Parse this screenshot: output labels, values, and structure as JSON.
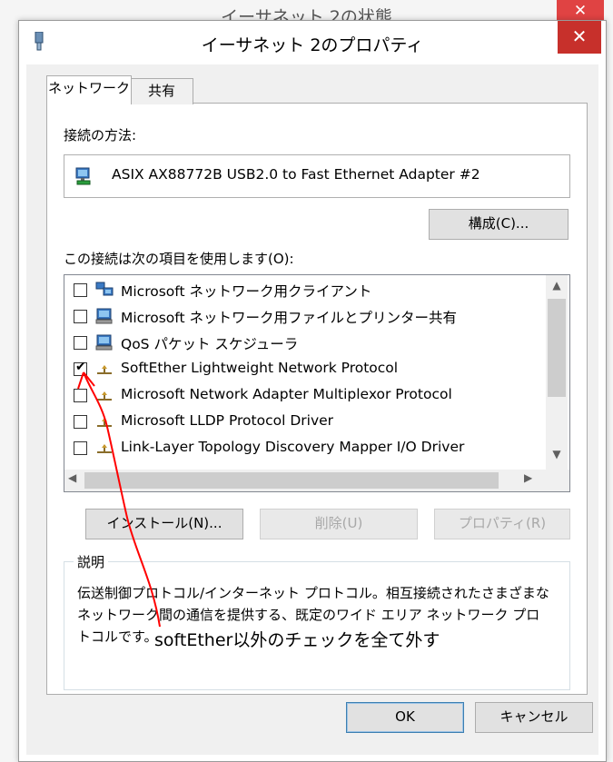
{
  "background_window": {
    "title": "イーサネット 2の状態",
    "close_glyph": "✕"
  },
  "dialog": {
    "title": "イーサネット 2のプロパティ",
    "close_glyph": "✕"
  },
  "tabs": [
    {
      "label": "ネットワーク",
      "selected": true
    },
    {
      "label": "共有",
      "selected": false
    }
  ],
  "connection": {
    "label": "接続の方法:",
    "adapter_name": "ASIX AX88772B USB2.0 to Fast Ethernet Adapter #2",
    "configure_button": "構成(C)..."
  },
  "items": {
    "label": "この接続は次の項目を使用します(O):",
    "list": [
      {
        "label": "Microsoft ネットワーク用クライアント",
        "checked": false,
        "icon": "network-client-icon"
      },
      {
        "label": "Microsoft ネットワーク用ファイルとプリンター共有",
        "checked": false,
        "icon": "file-printer-share-icon"
      },
      {
        "label": "QoS パケット スケジューラ",
        "checked": false,
        "icon": "qos-scheduler-icon"
      },
      {
        "label": "SoftEther Lightweight Network Protocol",
        "checked": true,
        "icon": "protocol-icon"
      },
      {
        "label": "Microsoft Network Adapter Multiplexor Protocol",
        "checked": false,
        "icon": "protocol-icon"
      },
      {
        "label": "Microsoft LLDP Protocol Driver",
        "checked": false,
        "icon": "protocol-icon"
      },
      {
        "label": "Link-Layer Topology Discovery Mapper I/O Driver",
        "checked": false,
        "icon": "protocol-icon"
      }
    ]
  },
  "buttons": {
    "install": "インストール(N)...",
    "uninstall": "削除(U)",
    "properties": "プロパティ(R)",
    "ok": "OK",
    "cancel": "キャンセル"
  },
  "description": {
    "legend": "説明",
    "text": "伝送制御プロトコル/インターネット プロトコル。相互接続されたさまざまなネットワーク間の通信を提供する、既定のワイド エリア ネットワーク プロトコルです。"
  },
  "annotation": {
    "text": "softEther以外のチェックを全て外す",
    "color": "#ff0000"
  },
  "colors": {
    "close_button": "#c7302b",
    "accent": "#3c7fb1"
  }
}
